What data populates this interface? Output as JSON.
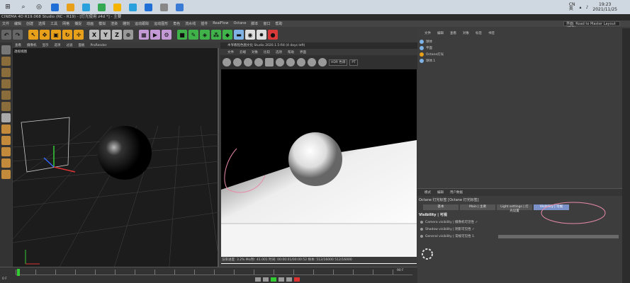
{
  "taskbar": {
    "apps": [
      "#1f6fd6",
      "#e8a01a",
      "#2aa0dc",
      "#34a853",
      "#f4b400",
      "#2aa0dc",
      "#1f6fd6",
      "#888888",
      "#3a7bd5"
    ],
    "tray_label": "CN\n英",
    "time": "19:23",
    "date": "2021/11/25"
  },
  "window": {
    "title": "CINEMA 4D R19.068 Studio (RC - R19) - [灯光使用 z4d *] - 主要"
  },
  "menu": [
    "文件",
    "编辑",
    "创建",
    "选择",
    "工具",
    "网格",
    "捕捉",
    "动画",
    "模拟",
    "渲染",
    "雕刻",
    "运动跟踪",
    "运动图形",
    "角色",
    "流水线",
    "插件",
    "RealFlow",
    "Octane",
    "脚本",
    "窗口",
    "帮助"
  ],
  "layout_label": "界面:",
  "layout_value": "Road to Master Layout (用户)",
  "vp1": {
    "menu": [
      "查看",
      "摄像机",
      "显示",
      "选项",
      "过滤",
      "面板",
      "ProRender"
    ],
    "label": "透视视图",
    "status": "网格间距：100 cm"
  },
  "vp2": {
    "title": "木爷教程色图文化 Studio 2020.1.5-R4 (4 days left)",
    "menu": [
      "文件",
      "云端",
      "对象",
      "比较",
      "选项",
      "帮助",
      "界面"
    ],
    "hdr": "HDR 色调",
    "pt": "PT",
    "status": "渲染进度: 3.2%  Ms/秒: 41.001  时间: 00:00:01/00:00:52  样本: 512/16000  512/16000"
  },
  "objects": {
    "menu": [
      "文件",
      "编辑",
      "查看",
      "对象",
      "标签",
      "书签"
    ],
    "items": [
      {
        "name": "球体",
        "color": "#7fb2e5"
      },
      {
        "name": "平面",
        "color": "#7fb2e5"
      },
      {
        "name": "Octane灯光",
        "color": "#e8a01a"
      },
      {
        "name": "球体.1",
        "color": "#7fb2e5"
      }
    ]
  },
  "attributes": {
    "menu": [
      "模式",
      "编辑",
      "用户数据"
    ],
    "title": "Octane 灯光标签 [Octane 灯光标签]",
    "tabs": [
      "基本",
      "Main | 主要",
      "Light settings | 灯光设置",
      "Visibility | 可视"
    ],
    "section": "Visibility | 可视",
    "props": [
      "Camera visibility | 摄像机可见性 ✓",
      "Shadow visibility | 阴影可见性 ✓",
      "General visibility | 常规可见性  1."
    ]
  },
  "timeline": {
    "start": "0 F",
    "end": "90 F"
  }
}
